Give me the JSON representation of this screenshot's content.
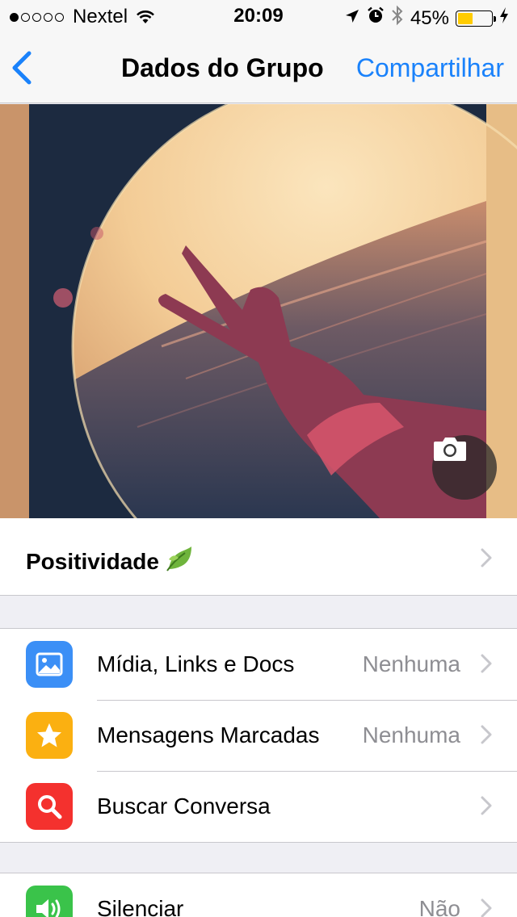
{
  "status_bar": {
    "carrier": "Nextel",
    "time": "20:09",
    "battery_percent": "45%",
    "battery_level": 0.45,
    "signal_bars_filled": 1,
    "signal_bars_total": 5
  },
  "nav": {
    "title": "Dados do Grupo",
    "action": "Compartilhar"
  },
  "group": {
    "name": "Positividade"
  },
  "sections": [
    {
      "rows": [
        {
          "label": "Mídia, Links e Docs",
          "value": "Nenhuma",
          "icon": "photo-icon",
          "color": "#3b8ff6"
        },
        {
          "label": "Mensagens Marcadas",
          "value": "Nenhuma",
          "icon": "star-icon",
          "color": "#fbb011"
        },
        {
          "label": "Buscar Conversa",
          "value": "",
          "icon": "search-icon",
          "color": "#f4312e"
        }
      ]
    },
    {
      "rows": [
        {
          "label": "Silenciar",
          "value": "Não",
          "icon": "speaker-icon",
          "color": "#3ac34a"
        }
      ]
    }
  ],
  "colors": {
    "accent": "#1a82fb",
    "separator": "#c8c7cc",
    "secondary_text": "#8e8e93"
  }
}
